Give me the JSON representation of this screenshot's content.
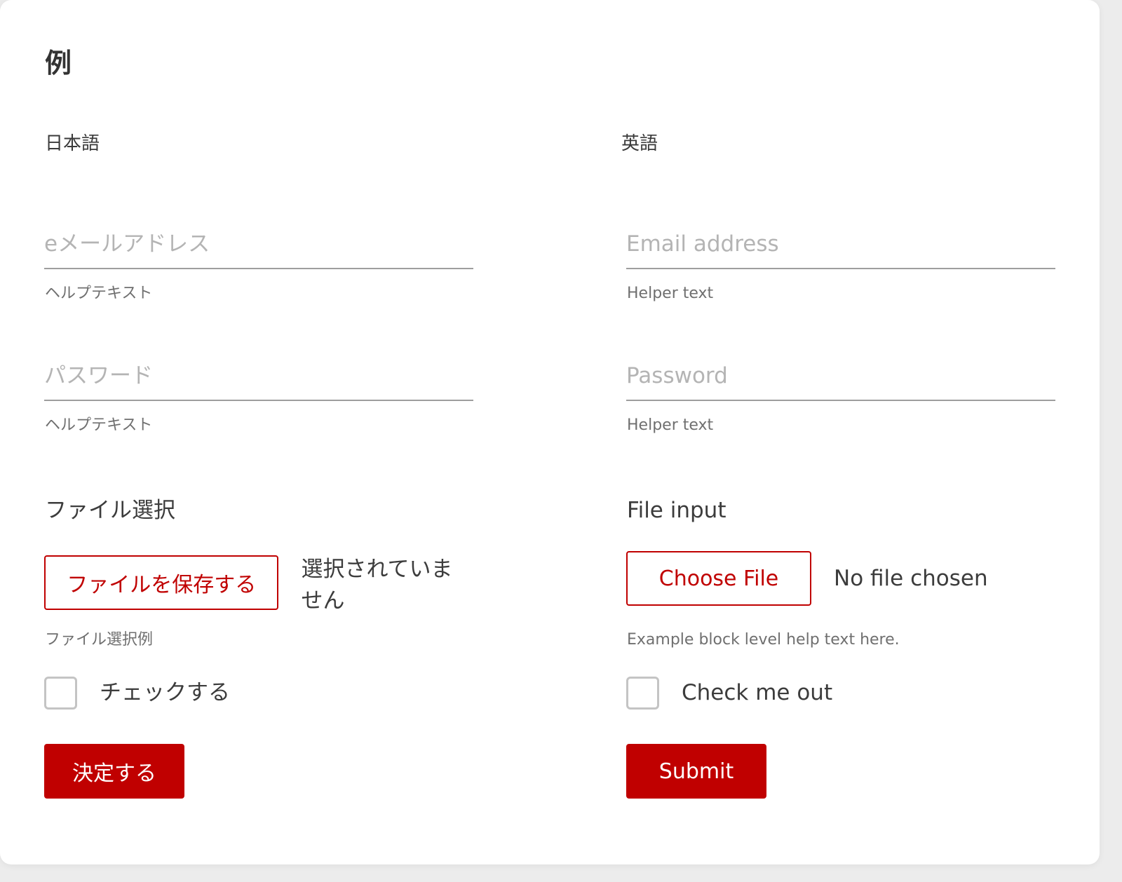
{
  "title": "例",
  "japanese": {
    "section_label": "日本語",
    "email": {
      "placeholder": "eメールアドレス",
      "helper": "ヘルプテキスト"
    },
    "password": {
      "placeholder": "パスワード",
      "helper": "ヘルプテキスト"
    },
    "file": {
      "label": "ファイル選択",
      "button": "ファイルを保存する",
      "status": "選択されていません",
      "helper": "ファイル選択例"
    },
    "checkbox_label": "チェックする",
    "submit": "決定する"
  },
  "english": {
    "section_label": "英語",
    "email": {
      "placeholder": "Email address",
      "helper": "Helper text"
    },
    "password": {
      "placeholder": "Password",
      "helper": "Helper text"
    },
    "file": {
      "label": "File input",
      "button": "Choose File",
      "status": "No file chosen",
      "helper": "Example block level help text here."
    },
    "checkbox_label": "Check me out",
    "submit": "Submit"
  },
  "colors": {
    "accent": "#c00000",
    "underline": "#9e9e9e",
    "placeholder": "#b4b4b4",
    "helper": "#6f6f6f"
  }
}
